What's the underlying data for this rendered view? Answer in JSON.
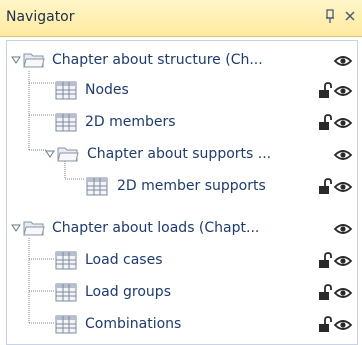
{
  "window": {
    "title": "Navigator",
    "pin_glyph": "p",
    "close_glyph": "×"
  },
  "tree": {
    "items": [
      {
        "label": "Chapter about structure (Ch...",
        "icon": "folder-icon",
        "expanded": true,
        "lock": false,
        "eye": true
      },
      {
        "label": "Nodes",
        "icon": "table-icon",
        "lock": true,
        "eye": true
      },
      {
        "label": "2D members",
        "icon": "table-icon",
        "lock": true,
        "eye": true
      },
      {
        "label": "Chapter about supports ...",
        "icon": "folder-icon",
        "expanded": true,
        "lock": false,
        "eye": true
      },
      {
        "label": "2D member supports",
        "icon": "table-icon",
        "lock": true,
        "eye": true
      },
      {
        "label": "Chapter about loads (Chapt...",
        "icon": "folder-icon",
        "expanded": true,
        "lock": false,
        "eye": true
      },
      {
        "label": "Load cases",
        "icon": "table-icon",
        "lock": true,
        "eye": true
      },
      {
        "label": "Load groups",
        "icon": "table-icon",
        "lock": true,
        "eye": true
      },
      {
        "label": "Combinations",
        "icon": "table-icon",
        "lock": true,
        "eye": true
      }
    ]
  }
}
